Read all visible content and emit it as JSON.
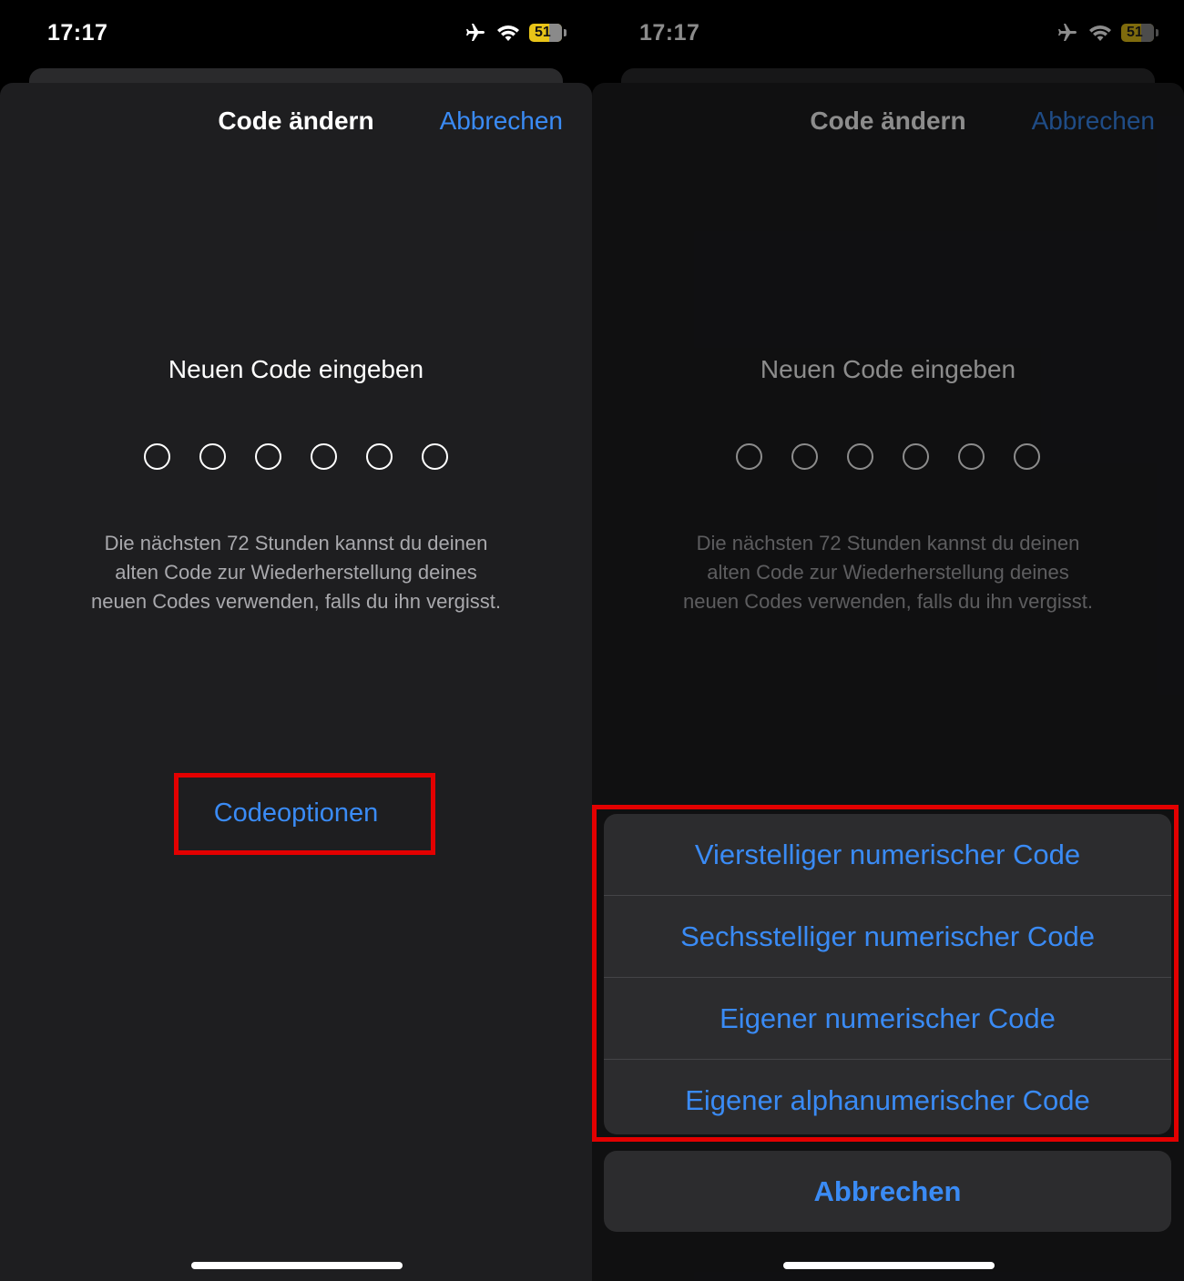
{
  "colors": {
    "accent": "#3a8bf5",
    "highlight": "#e30000",
    "sheet": "#1e1e20"
  },
  "status_bar": {
    "time": "17:17",
    "battery": "51",
    "icons": [
      "airplane-icon",
      "wifi-icon",
      "battery-icon"
    ]
  },
  "left": {
    "nav_title": "Code ändern",
    "nav_cancel": "Abbrechen",
    "prompt": "Neuen Code eingeben",
    "info_lines": [
      "Die nächsten 72 Stunden kannst du deinen",
      "alten Code zur Wiederherstellung deines",
      "neuen Codes verwenden, falls du ihn vergisst."
    ],
    "code_options": "Codeoptionen"
  },
  "right": {
    "nav_title": "Code ändern",
    "nav_cancel": "Abbrechen",
    "prompt": "Neuen Code eingeben",
    "info_lines": [
      "Die nächsten 72 Stunden kannst du deinen",
      "alten Code zur Wiederherstellung deines",
      "neuen Codes verwenden, falls du ihn vergisst."
    ],
    "actions": [
      "Vierstelliger numerischer Code",
      "Sechsstelliger numerischer Code",
      "Eigener numerischer Code",
      "Eigener alphanumerischer Code"
    ],
    "action_cancel": "Abbrechen"
  }
}
